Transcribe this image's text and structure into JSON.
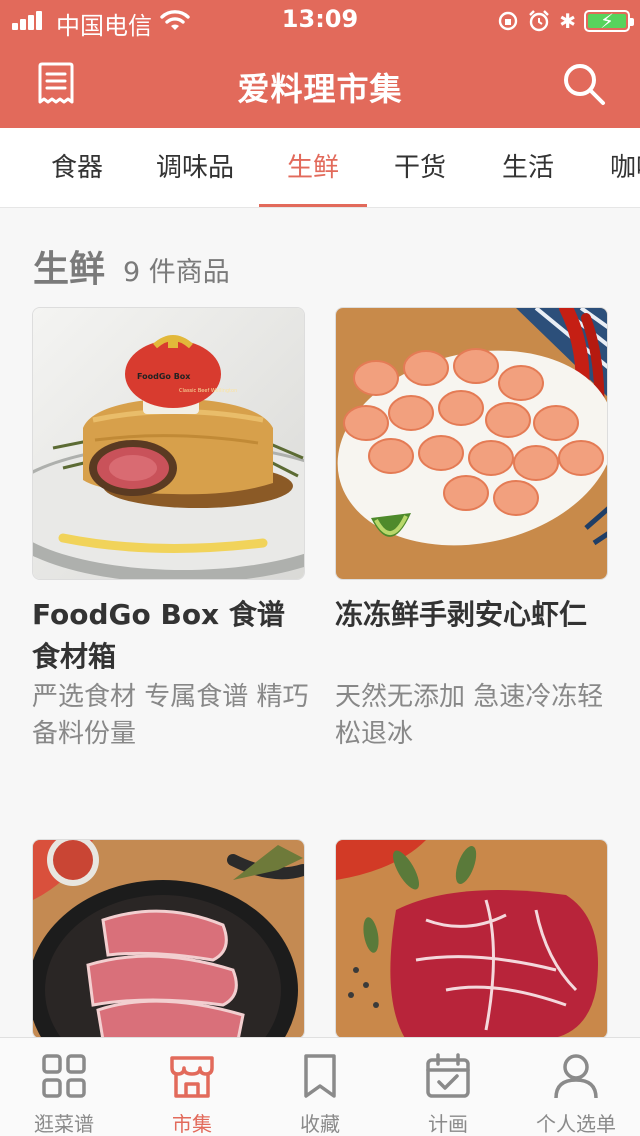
{
  "status_bar": {
    "carrier": "中国电信",
    "time": "13:09"
  },
  "header": {
    "title": "爱料理市集"
  },
  "tabs": [
    {
      "label": "食器"
    },
    {
      "label": "调味品"
    },
    {
      "label": "生鲜"
    },
    {
      "label": "干货"
    },
    {
      "label": "生活"
    },
    {
      "label": "咖啡"
    }
  ],
  "active_tab": "生鲜",
  "section": {
    "name": "生鲜",
    "count": "9 件商品"
  },
  "products": [
    {
      "title": "FoodGo Box 食谱食材箱",
      "desc": "严选食材 专属食谱 精巧备料份量",
      "image": "beef-wellington-photo",
      "box_label": "FoodGo Box",
      "box_sub": "Classic Beef Wellington"
    },
    {
      "title": "冻冻鲜手剥安心虾仁",
      "desc": "天然无添加 急速冷冻轻松退冰",
      "image": "shrimp-photo"
    },
    {
      "title": "",
      "desc": "",
      "image": "short-ribs-pan-photo"
    },
    {
      "title": "",
      "desc": "",
      "image": "marbled-steak-photo"
    }
  ],
  "tabbar": [
    {
      "label": "逛菜谱",
      "icon": "grid-icon"
    },
    {
      "label": "市集",
      "icon": "store-icon"
    },
    {
      "label": "收藏",
      "icon": "bookmark-icon"
    },
    {
      "label": "计画",
      "icon": "calendar-icon"
    },
    {
      "label": "个人选单",
      "icon": "user-icon"
    }
  ],
  "colors": {
    "brand": "#e26a5b",
    "battery": "#58d35d",
    "inactive": "#8a8a8a"
  }
}
